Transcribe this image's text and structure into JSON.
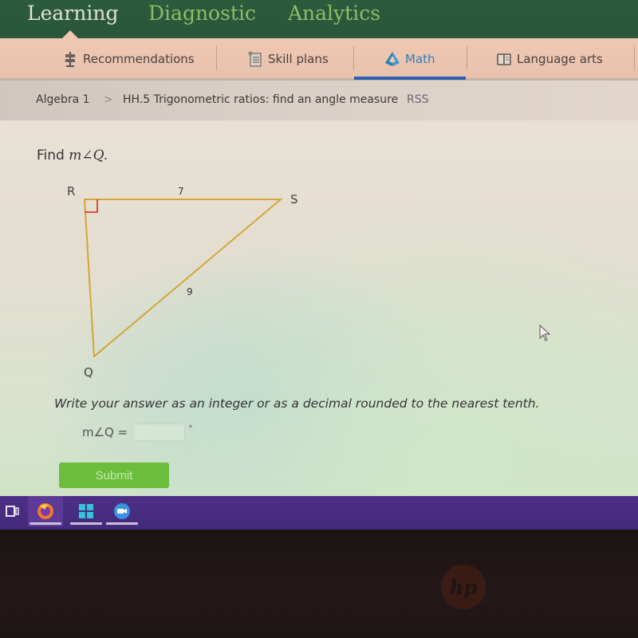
{
  "topnav": {
    "tabs": [
      {
        "label": "Learning",
        "active": true
      },
      {
        "label": "Diagnostic",
        "active": false
      },
      {
        "label": "Analytics",
        "active": false
      }
    ]
  },
  "subjects": [
    {
      "label": "Recommendations",
      "icon": "signpost-icon",
      "active": false
    },
    {
      "label": "Skill plans",
      "icon": "checklist-icon",
      "active": false
    },
    {
      "label": "Math",
      "icon": "pyramid-icon",
      "active": true
    },
    {
      "label": "Language arts",
      "icon": "book-icon",
      "active": false
    }
  ],
  "colors": {
    "nav_bg": "#2c5a3c",
    "nav_active": "#dfe3cf",
    "nav_inactive": "#8fbd67",
    "math_accent": "#2f7fb6",
    "submit_green": "#6cbd3c",
    "triangle_stroke": "#d4a534",
    "right_angle_marker": "#d8503a",
    "taskbar": "#4b2f86"
  },
  "breadcrumb": {
    "course": "Algebra 1",
    "separator": ">",
    "skill": "HH.5 Trigonometric ratios: find an angle measure",
    "code": "RSS"
  },
  "question": {
    "prompt_prefix": "Find ",
    "prompt_math": "m∠Q.",
    "figure": {
      "vertices": {
        "R": "R",
        "S": "S",
        "Q": "Q"
      },
      "right_angle_at": "R",
      "side_RS": "7",
      "side_QS": "9"
    },
    "instruction": "Write your answer as an integer or as a decimal rounded to the nearest tenth.",
    "answer_label": "m∠Q =",
    "answer_value": "",
    "answer_unit": "°",
    "submit_label": "Submit"
  },
  "taskbar": {
    "items": [
      {
        "name": "task-view",
        "active": false
      },
      {
        "name": "firefox",
        "active": true
      },
      {
        "name": "windows-store",
        "active": false
      },
      {
        "name": "zoom",
        "active": false
      }
    ]
  },
  "bezel": {
    "logo_text": "hp"
  }
}
